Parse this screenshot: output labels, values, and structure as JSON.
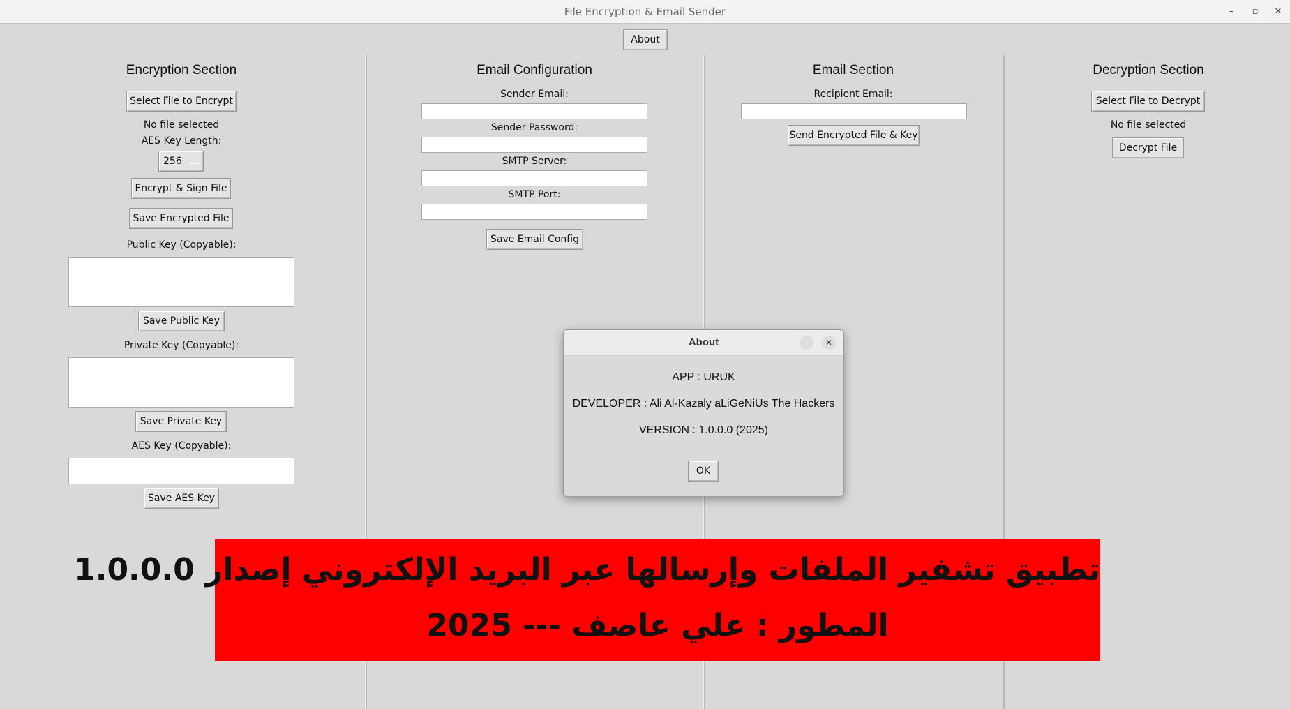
{
  "window": {
    "title": "File Encryption & Email Sender",
    "about_button": "About"
  },
  "encryption": {
    "heading": "Encryption Section",
    "select_button": "Select File to Encrypt",
    "file_status": "No file selected",
    "aes_key_length_label": "AES Key Length:",
    "aes_key_length_value": "256",
    "encrypt_button": "Encrypt & Sign File",
    "save_encrypted_button": "Save Encrypted File",
    "public_key_label": "Public Key (Copyable):",
    "save_public_key_button": "Save Public Key",
    "private_key_label": "Private Key (Copyable):",
    "save_private_key_button": "Save Private Key",
    "aes_key_label": "AES Key (Copyable):",
    "save_aes_key_button": "Save AES Key"
  },
  "email_config": {
    "heading": "Email Configuration",
    "sender_email_label": "Sender Email:",
    "sender_password_label": "Sender Password:",
    "smtp_server_label": "SMTP Server:",
    "smtp_port_label": "SMTP Port:",
    "save_button": "Save Email Config"
  },
  "email": {
    "heading": "Email Section",
    "recipient_label": "Recipient Email:",
    "send_button": "Send Encrypted File & Key"
  },
  "decryption": {
    "heading": "Decryption Section",
    "select_button": "Select File to Decrypt",
    "file_status": "No file selected",
    "decrypt_button": "Decrypt File"
  },
  "about_dialog": {
    "title": "About",
    "app_line": "APP : URUK",
    "developer_line": "DEVELOPER : Ali Al-Kazaly aLiGeNiUs The Hackers",
    "version_line": "VERSION : 1.0.0.0  (2025)",
    "ok_button": "OK"
  },
  "banner": {
    "line1": "تطبيق تشفير الملفات وإرسالها عبر البريد الإلكتروني   إصدار 1.0.0.0",
    "line2": "المطور  :  علي عاصف   ---   2025",
    "background_color": "#ff0000"
  }
}
